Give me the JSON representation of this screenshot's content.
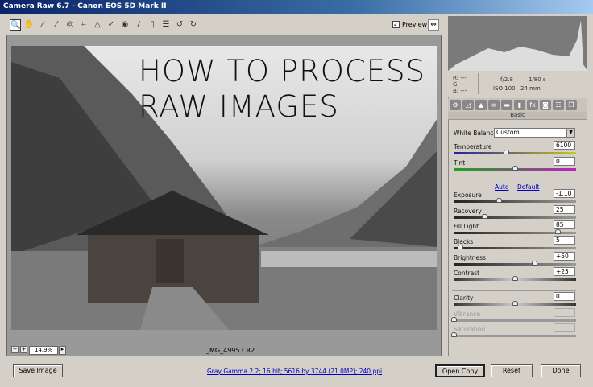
{
  "window": {
    "title": "Camera Raw 6.7  -  Canon EOS 5D Mark II"
  },
  "toolbar": {
    "tools": [
      "zoom-icon",
      "hand-icon",
      "white-balance-icon",
      "color-sampler-icon",
      "target-adjust-icon",
      "crop-icon",
      "straighten-icon",
      "spot-removal-icon",
      "red-eye-icon",
      "adjustment-brush-icon",
      "graduated-filter-icon",
      "preferences-icon",
      "rotate-left-icon",
      "rotate-right-icon"
    ],
    "preview_label": "Preview",
    "preview_checked": true
  },
  "image": {
    "headline_line1": "HOW TO PROCESS",
    "headline_line2": "RAW IMAGES",
    "zoom": "14.9%",
    "filename": "_MG_4995.CR2"
  },
  "info": {
    "r": "R:",
    "g": "G:",
    "b": "B:",
    "dash": "---",
    "aperture": "f/2.8",
    "shutter": "1/80 s",
    "iso": "ISO 100",
    "focal": "24 mm"
  },
  "panel": {
    "title": "Basic",
    "white_balance_label": "White Balance:",
    "white_balance_value": "Custom",
    "auto": "Auto",
    "default": "Default",
    "sliders": [
      {
        "label": "Temperature",
        "value": "6100",
        "pos": 0.43
      },
      {
        "label": "Tint",
        "value": "0",
        "pos": 0.5
      },
      {
        "label": "Exposure",
        "value": "-1.10",
        "pos": 0.37
      },
      {
        "label": "Recovery",
        "value": "25",
        "pos": 0.25
      },
      {
        "label": "Fill Light",
        "value": "85",
        "pos": 0.85
      },
      {
        "label": "Blacks",
        "value": "5",
        "pos": 0.05
      },
      {
        "label": "Brightness",
        "value": "+50",
        "pos": 0.66
      },
      {
        "label": "Contrast",
        "value": "+25",
        "pos": 0.5
      },
      {
        "label": "Clarity",
        "value": "0",
        "pos": 0.5
      },
      {
        "label": "Vibrance",
        "value": "",
        "pos": 0
      },
      {
        "label": "Saturation",
        "value": "",
        "pos": 0
      }
    ]
  },
  "footer": {
    "save": "Save Image",
    "workflow": "Gray Gamma 2.2; 16 bit; 5616 by 3744 (21.0MP); 240 ppi",
    "open": "Open Copy",
    "reset": "Reset",
    "done": "Done"
  }
}
